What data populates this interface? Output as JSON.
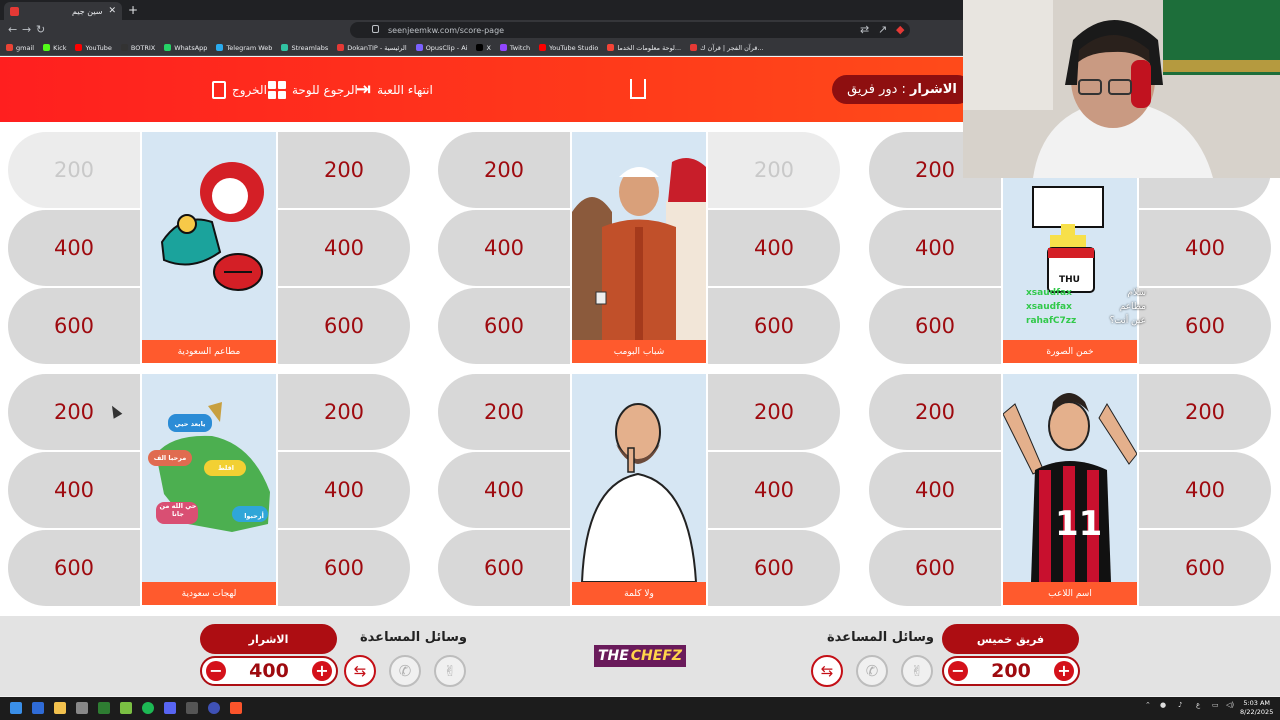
{
  "browser": {
    "tab_title": "سين جيم",
    "url": "seenjeemkw.com/score-page",
    "bookmarks": [
      "gmail",
      "Kick",
      "YouTube",
      "BOTRIX",
      "WhatsApp",
      "Telegram Web",
      "Streamlabs",
      "DokanTIP - الرئيسية",
      "OpusClip - Ai",
      "X",
      "Twitch",
      "YouTube Studio",
      "لوحة معلومات الخدما...",
      "قرآن الفجر | قرآن ك..."
    ]
  },
  "header": {
    "exit_label": "الخروج",
    "back_label": "الرجوع للوحة",
    "end_label": "انتهاء اللعبة",
    "turn_prefix": "دور فريق :",
    "turn_team": "الاشرار"
  },
  "board": {
    "columns": [
      {
        "category": "مطاعم السعودية",
        "left": [
          "200",
          "400",
          "600"
        ],
        "right": [
          "200",
          "400",
          "600"
        ],
        "left_used": [
          true,
          false,
          false
        ],
        "right_used": [
          false,
          false,
          false
        ]
      },
      {
        "category": "شباب البومب",
        "left": [
          "200",
          "400",
          "600"
        ],
        "right": [
          "200",
          "400",
          "600"
        ],
        "left_used": [
          false,
          false,
          false
        ],
        "right_used": [
          true,
          false,
          false
        ]
      },
      {
        "category": "خمن الصورة",
        "left": [
          "200",
          "400",
          "600"
        ],
        "right": [
          "200",
          "400",
          "600"
        ],
        "left_used": [
          false,
          false,
          false
        ],
        "right_used": [
          false,
          false,
          false
        ]
      },
      {
        "category": "لهجات سعودية",
        "left": [
          "200",
          "400",
          "600"
        ],
        "right": [
          "200",
          "400",
          "600"
        ],
        "left_used": [
          false,
          false,
          false
        ],
        "right_used": [
          false,
          false,
          false
        ]
      },
      {
        "category": "ولا كلمة",
        "left": [
          "200",
          "400",
          "600"
        ],
        "right": [
          "200",
          "400",
          "600"
        ],
        "left_used": [
          false,
          false,
          false
        ],
        "right_used": [
          false,
          false,
          false
        ]
      },
      {
        "category": "اسم اللاعب",
        "left": [
          "200",
          "400",
          "600"
        ],
        "right": [
          "200",
          "400",
          "600"
        ],
        "left_used": [
          false,
          false,
          false
        ],
        "right_used": [
          false,
          false,
          false
        ]
      }
    ],
    "dialect_bubbles": [
      "يابعد حيي",
      "مرحبا الف",
      "اقلط",
      "حي الله من جانا",
      "أرحبوا"
    ],
    "jersey_number": "11",
    "calendar_day": "THU"
  },
  "chat": [
    {
      "user": "xsaudfax",
      "msg": "سلام"
    },
    {
      "user": "xsaudfax",
      "msg": "مطاعم"
    },
    {
      "user": "rahafC7zz",
      "msg": "عين أنت؟"
    }
  ],
  "footer": {
    "left_team": {
      "name": "الاشرار",
      "score": "400",
      "aids_label": "وسائل المساعدة"
    },
    "right_team": {
      "name": "فريق خميس",
      "score": "200",
      "aids_label": "وسائل المساعدة"
    },
    "logo_a": "THE",
    "logo_b": "CHEFZ",
    "minus": "−",
    "plus": "+"
  },
  "taskbar": {
    "time": "5:03 AM",
    "date": "8/22/2025"
  },
  "colors": {
    "header_start": "#ff1f1f",
    "header_end": "#ff5a1a",
    "accent_dark": "#ad0d12",
    "value_text": "#9e0a0f",
    "caption_bar": "#ff5a2d",
    "logo_bg": "#6a1b5b"
  }
}
